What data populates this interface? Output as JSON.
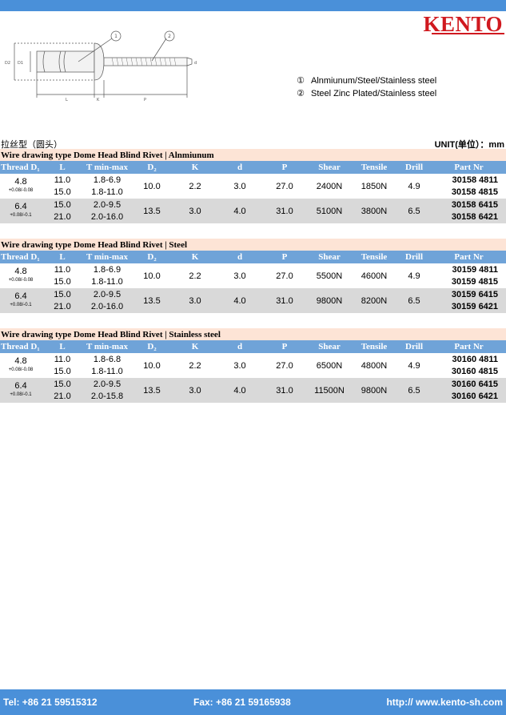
{
  "brand": {
    "logo": "KENTO"
  },
  "drawing": {
    "callouts": [
      "1",
      "2"
    ],
    "dims": [
      "D2",
      "D1",
      "L",
      "K",
      "P",
      "d"
    ]
  },
  "legend": [
    {
      "num": "①",
      "text": "Alnmiunum/Steel/Stainless steel"
    },
    {
      "num": "②",
      "text": "Steel Zinc Plated/Stainless steel"
    }
  ],
  "subhead": {
    "cn": "拉丝型（圆头）",
    "unit": "UNIT(单位）：mm"
  },
  "headers": [
    "Thread D₁",
    "L",
    "T min-max",
    "D₂",
    "K",
    "d",
    "P",
    "Shear",
    "Tensile",
    "Drill",
    "Part Nr"
  ],
  "sections": [
    {
      "title": "Wire drawing type Dome Head Blind Rivet | Alnmiunum",
      "groups": [
        {
          "thread": "4.8",
          "tol": "+0.08/-0.08",
          "rows": [
            {
              "L": "11.0",
              "T": "1.8-6.9",
              "pn": "30158 4811"
            },
            {
              "L": "15.0",
              "T": "1.8-11.0",
              "pn": "30158 4815"
            }
          ],
          "D2": "10.0",
          "K": "2.2",
          "d": "3.0",
          "P": "27.0",
          "shear": "2400N",
          "tensile": "1850N",
          "drill": "4.9"
        },
        {
          "thread": "6.4",
          "tol": "+0.08/-0.1",
          "rows": [
            {
              "L": "15.0",
              "T": "2.0-9.5",
              "pn": "30158 6415"
            },
            {
              "L": "21.0",
              "T": "2.0-16.0",
              "pn": "30158 6421"
            }
          ],
          "D2": "13.5",
          "K": "3.0",
          "d": "4.0",
          "P": "31.0",
          "shear": "5100N",
          "tensile": "3800N",
          "drill": "6.5"
        }
      ]
    },
    {
      "title": "Wire drawing type Dome Head Blind Rivet | Steel",
      "groups": [
        {
          "thread": "4.8",
          "tol": "+0.08/-0.08",
          "rows": [
            {
              "L": "11.0",
              "T": "1.8-6.9",
              "pn": "30159 4811"
            },
            {
              "L": "15.0",
              "T": "1.8-11.0",
              "pn": "30159 4815"
            }
          ],
          "D2": "10.0",
          "K": "2.2",
          "d": "3.0",
          "P": "27.0",
          "shear": "5500N",
          "tensile": "4600N",
          "drill": "4.9"
        },
        {
          "thread": "6.4",
          "tol": "+0.08/-0.1",
          "rows": [
            {
              "L": "15.0",
              "T": "2.0-9.5",
              "pn": "30159 6415"
            },
            {
              "L": "21.0",
              "T": "2.0-16.0",
              "pn": "30159 6421"
            }
          ],
          "D2": "13.5",
          "K": "3.0",
          "d": "4.0",
          "P": "31.0",
          "shear": "9800N",
          "tensile": "8200N",
          "drill": "6.5"
        }
      ]
    },
    {
      "title": "Wire drawing type Dome Head Blind Rivet | Stainless steel",
      "groups": [
        {
          "thread": "4.8",
          "tol": "+0.08/-0.08",
          "rows": [
            {
              "L": "11.0",
              "T": "1.8-6.8",
              "pn": "30160 4811"
            },
            {
              "L": "15.0",
              "T": "1.8-11.0",
              "pn": "30160 4815"
            }
          ],
          "D2": "10.0",
          "K": "2.2",
          "d": "3.0",
          "P": "27.0",
          "shear": "6500N",
          "tensile": "4800N",
          "drill": "4.9"
        },
        {
          "thread": "6.4",
          "tol": "+0.08/-0.1",
          "rows": [
            {
              "L": "15.0",
              "T": "2.0-9.5",
              "pn": "30160 6415"
            },
            {
              "L": "21.0",
              "T": "2.0-15.8",
              "pn": "30160 6421"
            }
          ],
          "D2": "13.5",
          "K": "3.0",
          "d": "4.0",
          "P": "31.0",
          "shear": "11500N",
          "tensile": "9800N",
          "drill": "6.5"
        }
      ]
    }
  ],
  "footer": {
    "tel": "Tel: +86 21 59515312",
    "fax": "Fax: +86 21 59165938",
    "web": "http:// www.kento-sh.com"
  },
  "colors": {
    "bar": "#4a90d9",
    "header": "#6fa3d8",
    "section": "#fde4d6",
    "stripe": "#d9d9d9",
    "logo": "#d0191f"
  }
}
